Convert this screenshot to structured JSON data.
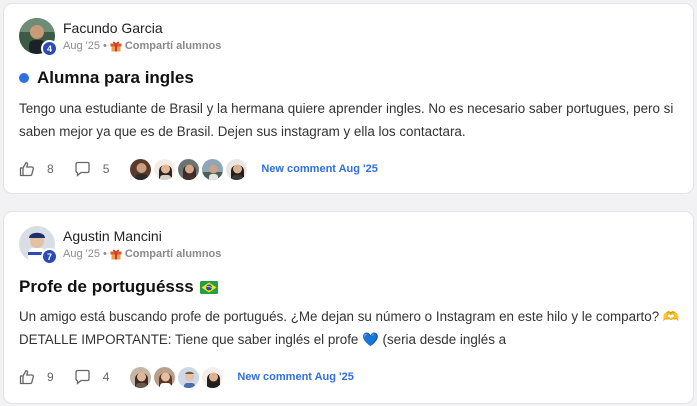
{
  "posts": [
    {
      "author": "Facundo Garcia",
      "level": "4",
      "date": "Aug '25",
      "separator": "•",
      "category": "Compartí alumnos",
      "title": "Alumna para ingles",
      "unread": true,
      "body": "Tengo una estudiante de Brasil y la hermana quiere aprender ingles. No es necesario saber portugues, pero si saben mejor ya que es de Brasil. Dejen sus instagram y ella los contactara.",
      "likes": "8",
      "comments": "5",
      "commenter_count": 5,
      "new_comment": "New comment Aug '25"
    },
    {
      "author": "Agustin Mancini",
      "level": "7",
      "date": "Aug '25",
      "separator": "•",
      "category": "Compartí alumnos",
      "title": "Profe de portuguésss",
      "title_emoji": "brazil-flag",
      "body": "Un amigo está buscando profe de portugués. ¿Me dejan su número o Instagram en este hilo y le comparto? 🫶 DETALLE IMPORTANTE: Tiene que saber inglés el profe 💙 (seria desde inglés a",
      "likes": "9",
      "comments": "4",
      "commenter_count": 4,
      "new_comment": "New comment Aug '25"
    }
  ],
  "colors": {
    "accent": "#2f6fe0",
    "badge": "#2c4ab5",
    "card_bg": "#ffffff",
    "page_bg": "#f2f2f4"
  }
}
